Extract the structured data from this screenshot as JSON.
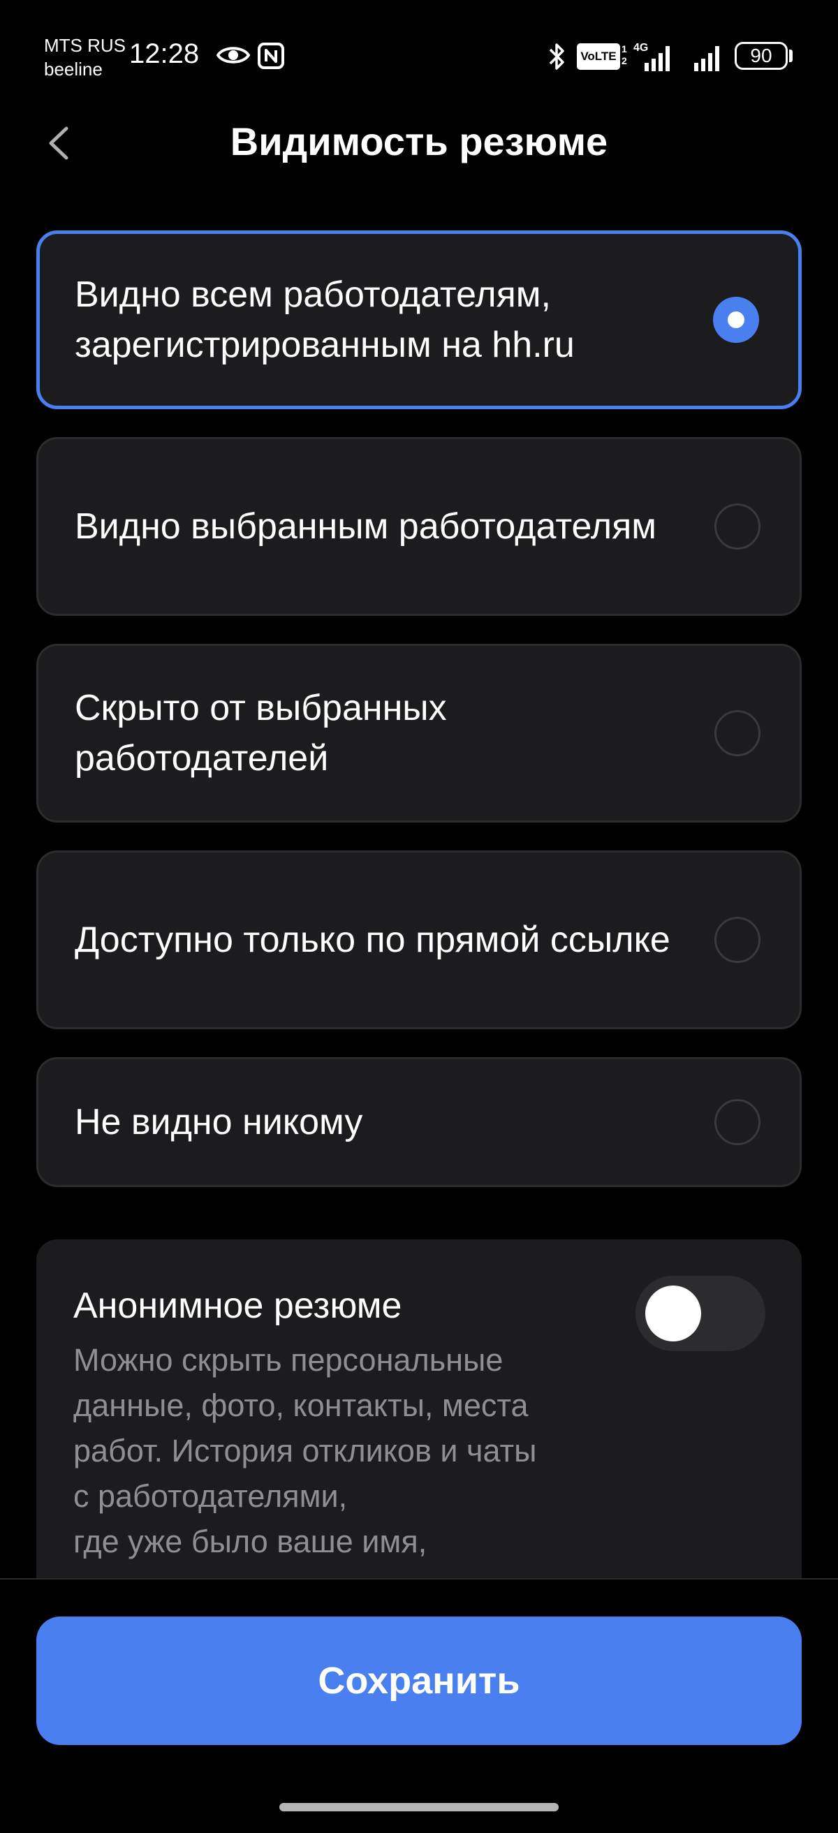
{
  "status_bar": {
    "carrier_1": "MTS RUS",
    "carrier_2": "beeline",
    "time": "12:28",
    "volte": "VoLTE",
    "sim_numbers": "1\n2",
    "network": "4G",
    "battery": "90",
    "icons": [
      "eye-icon",
      "nfc-icon",
      "bluetooth-icon",
      "signal-icon",
      "battery-icon"
    ]
  },
  "header": {
    "title": "Видимость резюме",
    "back_icon": "chevron-left-icon"
  },
  "options": [
    {
      "label": "Видно всем работодателям, зарегистрированным на hh.ru",
      "selected": true
    },
    {
      "label": "Видно выбранным работодателям",
      "selected": false
    },
    {
      "label": "Скрыто от выбранных работодателей",
      "selected": false
    },
    {
      "label": "Доступно только по прямой ссылке",
      "selected": false
    },
    {
      "label": "Не видно никому",
      "selected": false
    }
  ],
  "anonymous": {
    "title": "Анонимное резюме",
    "description_lines": [
      "Можно скрыть персональные",
      "данные, фото, контакты, места",
      "работ. История откликов и чаты",
      "с работодателями,",
      "где уже было ваше имя,"
    ],
    "enabled": false
  },
  "footer": {
    "save_label": "Сохранить"
  },
  "colors": {
    "accent": "#4a7ff0",
    "card_bg": "#1c1c1e",
    "secondary_text": "#8e8e93",
    "background": "#000000"
  }
}
